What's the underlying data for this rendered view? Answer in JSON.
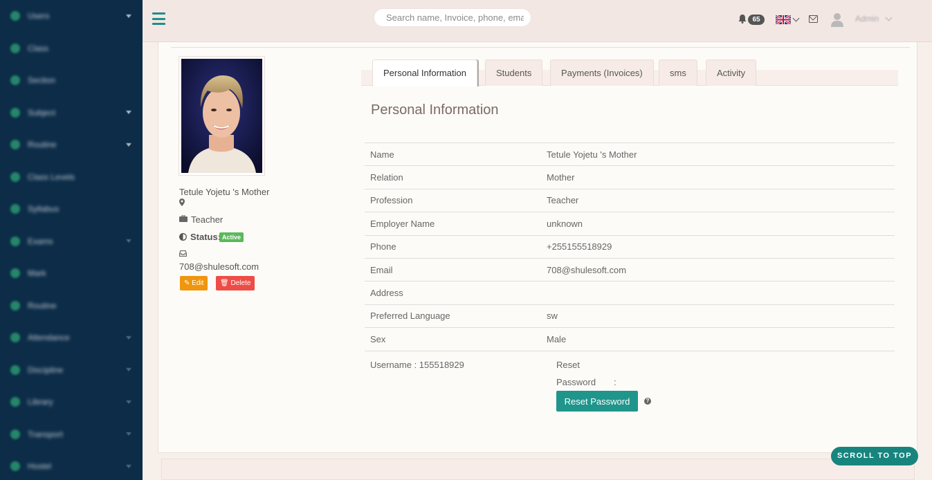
{
  "sidebar": {
    "items": [
      {
        "label": "Users",
        "caret": true
      },
      {
        "label": "Class",
        "caret": false
      },
      {
        "label": "Section",
        "caret": false
      },
      {
        "label": "Subject",
        "caret": true
      },
      {
        "label": "Routine",
        "caret": true
      },
      {
        "label": "Class Levels",
        "caret": false
      },
      {
        "label": "Syllabus",
        "caret": false
      },
      {
        "label": "Exams",
        "caret": true
      },
      {
        "label": "Mark",
        "caret": false
      },
      {
        "label": "Routine",
        "caret": false
      },
      {
        "label": "Attendance",
        "caret": true
      },
      {
        "label": "Discipline",
        "caret": true
      },
      {
        "label": "Library",
        "caret": true
      },
      {
        "label": "Transport",
        "caret": true
      },
      {
        "label": "Hostel",
        "caret": true
      }
    ]
  },
  "topbar": {
    "search_placeholder": "Search name, Invoice, phone, email",
    "notifications_count": "65",
    "user_label": "Admin"
  },
  "profile": {
    "name": "Tetule Yojetu 's Mother",
    "profession": "Teacher",
    "status_label": "Status:",
    "status_value": "Active",
    "email": "708@shulesoft.com",
    "edit_label": "Edit",
    "delete_label": "Delete"
  },
  "tabs": [
    {
      "label": "Personal Information",
      "active": true
    },
    {
      "label": "Students",
      "active": false
    },
    {
      "label": "Payments (Invoices)",
      "active": false
    },
    {
      "label": "sms",
      "active": false
    },
    {
      "label": "Activity",
      "active": false
    }
  ],
  "section_title": "Personal Information",
  "info_rows": [
    {
      "key": "Name",
      "value": "Tetule Yojetu 's Mother"
    },
    {
      "key": "Relation",
      "value": "Mother"
    },
    {
      "key": "Profession",
      "value": "Teacher"
    },
    {
      "key": "Employer Name",
      "value": "unknown"
    },
    {
      "key": "Phone",
      "value": "+255155518929"
    },
    {
      "key": "Email",
      "value": "708@shulesoft.com"
    },
    {
      "key": "Address",
      "value": ""
    },
    {
      "key": "Preferred Language",
      "value": "sw"
    },
    {
      "key": "Sex",
      "value": "Male"
    }
  ],
  "account": {
    "username_line": "Username : 155518929",
    "reset_label_1": "Reset",
    "reset_label_2": "Password",
    "reset_colon": ":",
    "reset_button": "Reset Password",
    "help_glyph": "?"
  },
  "scroll_top_label": "SCROLL TO TOP",
  "colors": {
    "sidebar_bg": "#0c2c48",
    "accent_teal": "#1f958c",
    "edit_orange": "#f0960e",
    "delete_red": "#ee4d46",
    "status_green": "#5cb85c"
  }
}
